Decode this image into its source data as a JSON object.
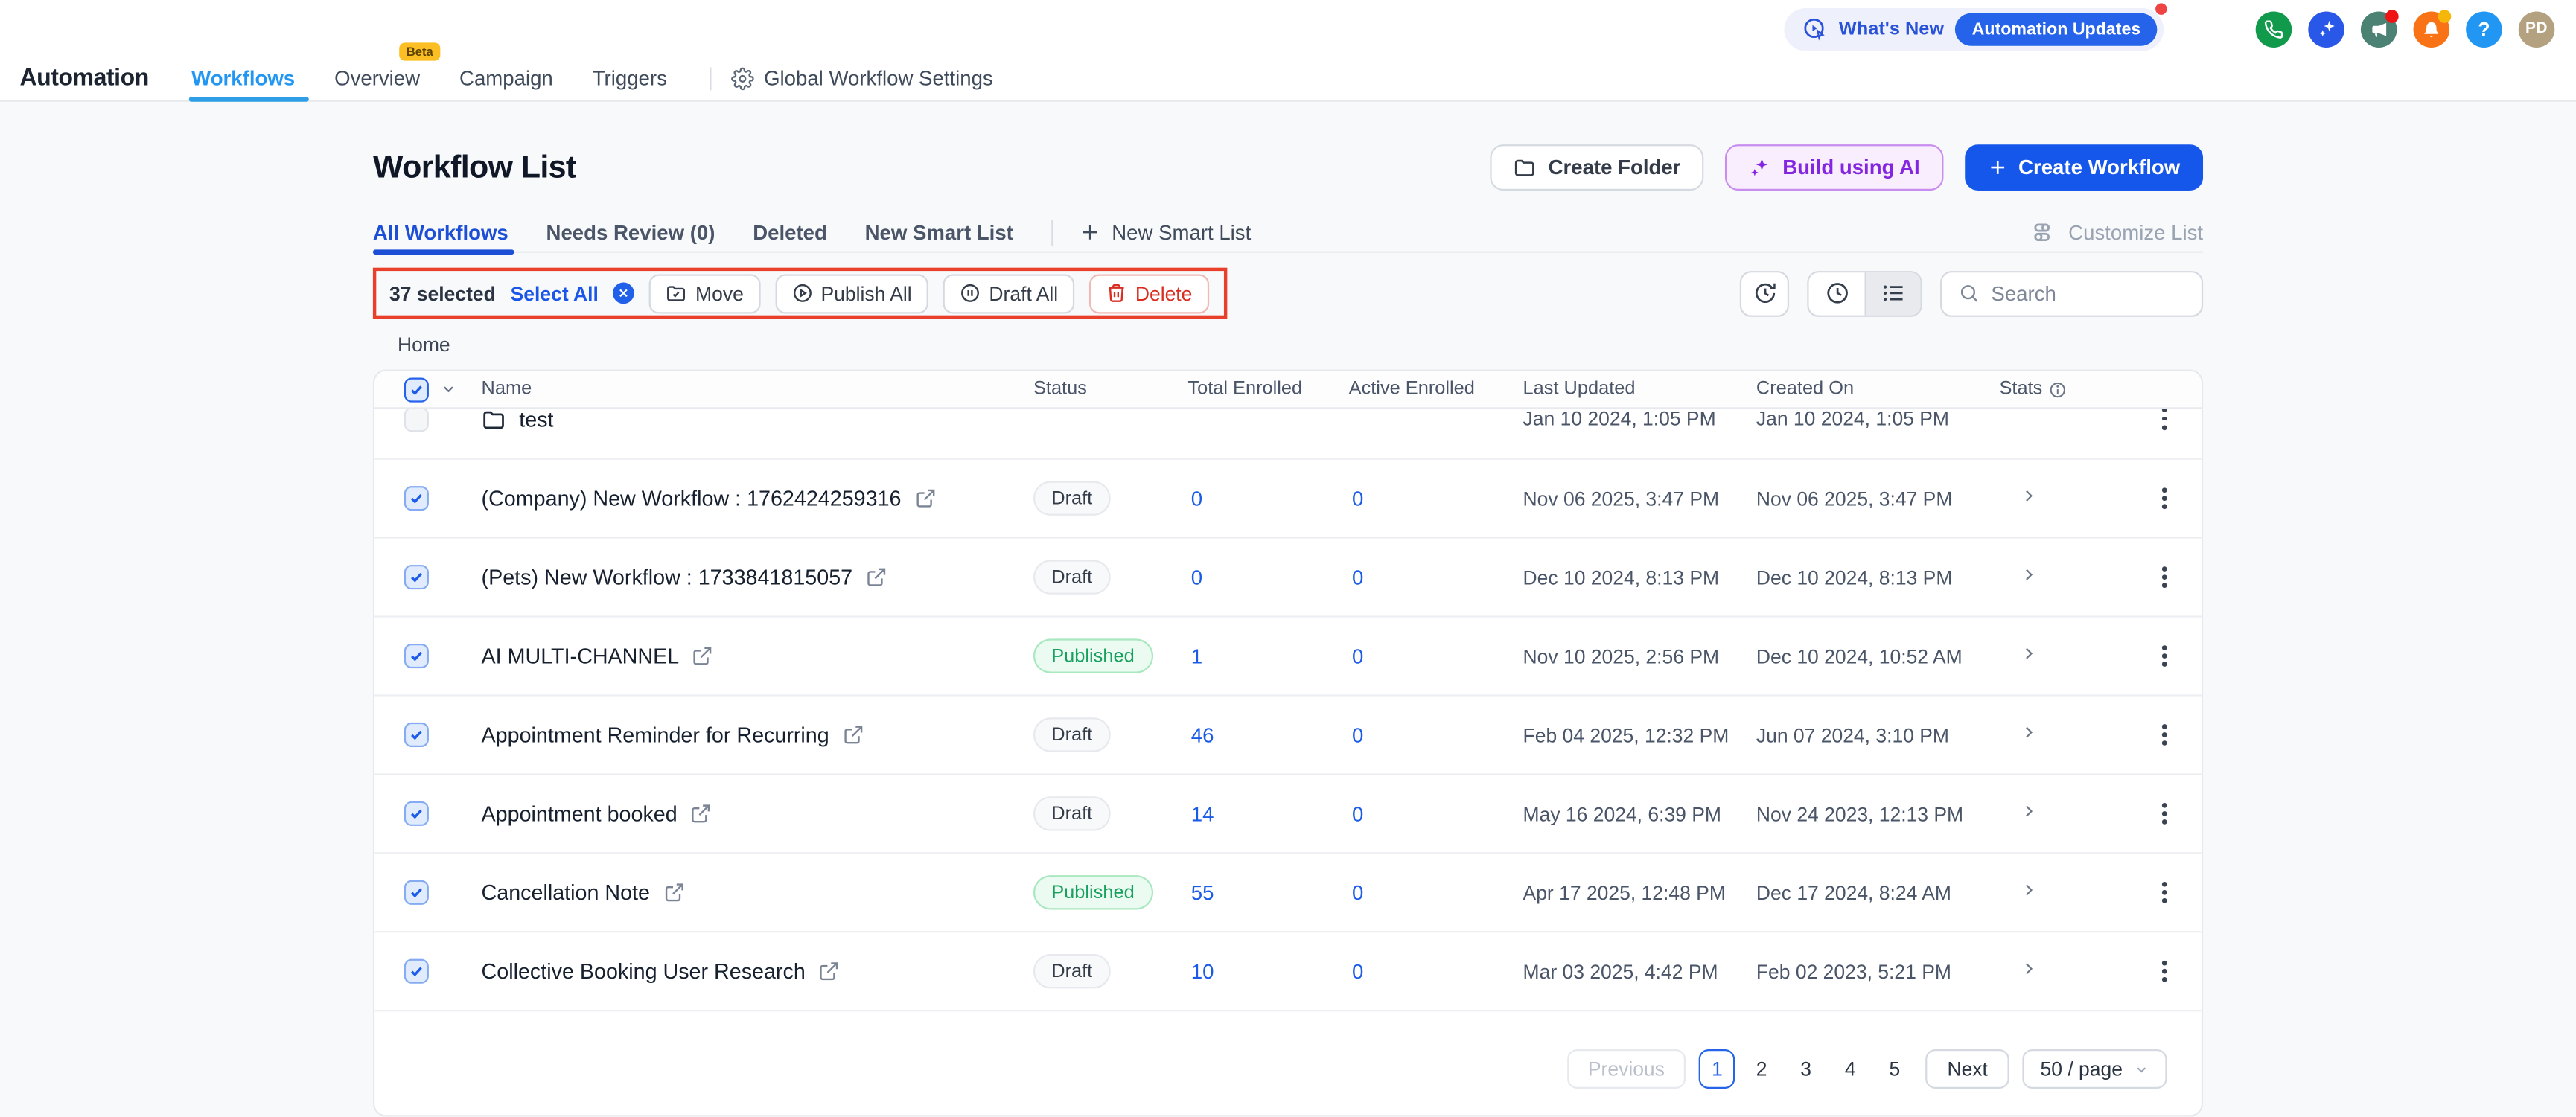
{
  "topbar": {
    "whats_new": "What's New",
    "updates_badge": "Automation Updates",
    "avatar_initials": "PD"
  },
  "nav": {
    "app_title": "Automation",
    "items": [
      {
        "label": "Workflows",
        "active": true
      },
      {
        "label": "Overview",
        "active": false,
        "badge": "Beta"
      },
      {
        "label": "Campaign",
        "active": false
      },
      {
        "label": "Triggers",
        "active": false
      }
    ],
    "settings_label": "Global Workflow Settings"
  },
  "header": {
    "title": "Workflow List",
    "create_folder": "Create Folder",
    "build_using_ai": "Build using AI",
    "create_workflow": "Create Workflow"
  },
  "tabs": {
    "items": [
      {
        "label": "All Workflows",
        "active": true
      },
      {
        "label": "Needs Review (0)",
        "active": false
      },
      {
        "label": "Deleted",
        "active": false
      },
      {
        "label": "New Smart List",
        "active": false
      }
    ],
    "new_smart_list_action": "New Smart List",
    "customize_list": "Customize List"
  },
  "selection_bar": {
    "selected_count": "37 selected",
    "select_all": "Select All",
    "move": "Move",
    "publish_all": "Publish All",
    "draft_all": "Draft All",
    "delete": "Delete"
  },
  "search": {
    "placeholder": "Search"
  },
  "breadcrumb": {
    "home": "Home"
  },
  "table": {
    "columns": {
      "name": "Name",
      "status": "Status",
      "total_enrolled": "Total Enrolled",
      "active_enrolled": "Active Enrolled",
      "last_updated": "Last Updated",
      "created_on": "Created On",
      "stats": "Stats"
    },
    "rows": [
      {
        "name": "test",
        "type": "folder",
        "checked": false,
        "clipped": true,
        "status": "",
        "total_enrolled": "",
        "active_enrolled": "",
        "last_updated": "Jan 10 2024, 1:05 PM",
        "created_on": "Jan 10 2024, 1:05 PM"
      },
      {
        "name": "(Company) New Workflow : 1762424259316",
        "type": "workflow",
        "checked": true,
        "clipped": false,
        "status": "Draft",
        "total_enrolled": "0",
        "active_enrolled": "0",
        "last_updated": "Nov 06 2025, 3:47 PM",
        "created_on": "Nov 06 2025, 3:47 PM"
      },
      {
        "name": "(Pets) New Workflow : 1733841815057",
        "type": "workflow",
        "checked": true,
        "clipped": false,
        "status": "Draft",
        "total_enrolled": "0",
        "active_enrolled": "0",
        "last_updated": "Dec 10 2024, 8:13 PM",
        "created_on": "Dec 10 2024, 8:13 PM"
      },
      {
        "name": "AI MULTI-CHANNEL",
        "type": "workflow",
        "checked": true,
        "clipped": false,
        "status": "Published",
        "total_enrolled": "1",
        "active_enrolled": "0",
        "last_updated": "Nov 10 2025, 2:56 PM",
        "created_on": "Dec 10 2024, 10:52 AM"
      },
      {
        "name": "Appointment Reminder for Recurring",
        "type": "workflow",
        "checked": true,
        "clipped": false,
        "status": "Draft",
        "total_enrolled": "46",
        "active_enrolled": "0",
        "last_updated": "Feb 04 2025, 12:32 PM",
        "created_on": "Jun 07 2024, 3:10 PM"
      },
      {
        "name": "Appointment booked",
        "type": "workflow",
        "checked": true,
        "clipped": false,
        "status": "Draft",
        "total_enrolled": "14",
        "active_enrolled": "0",
        "last_updated": "May 16 2024, 6:39 PM",
        "created_on": "Nov 24 2023, 12:13 PM"
      },
      {
        "name": "Cancellation Note",
        "type": "workflow",
        "checked": true,
        "clipped": false,
        "status": "Published",
        "total_enrolled": "55",
        "active_enrolled": "0",
        "last_updated": "Apr 17 2025, 12:48 PM",
        "created_on": "Dec 17 2024, 8:24 AM"
      },
      {
        "name": "Collective Booking User Research",
        "type": "workflow",
        "checked": true,
        "clipped": false,
        "status": "Draft",
        "total_enrolled": "10",
        "active_enrolled": "0",
        "last_updated": "Mar 03 2025, 4:42 PM",
        "created_on": "Feb 02 2023, 5:21 PM"
      }
    ]
  },
  "pagination": {
    "previous": "Previous",
    "pages": [
      "1",
      "2",
      "3",
      "4",
      "5"
    ],
    "active_page": "1",
    "next": "Next",
    "page_size": "50 / page"
  },
  "colors": {
    "primary_blue": "#1556eb",
    "nav_active_blue": "#2196f3",
    "tab_active_blue": "#1d4fd6",
    "published_green": "#17a05e",
    "delete_red": "#d92d20",
    "annotation_red": "#e8402a",
    "beta_amber": "#fbbf24",
    "notification_red": "#ef4444",
    "notification_amber": "#f5b70a"
  }
}
